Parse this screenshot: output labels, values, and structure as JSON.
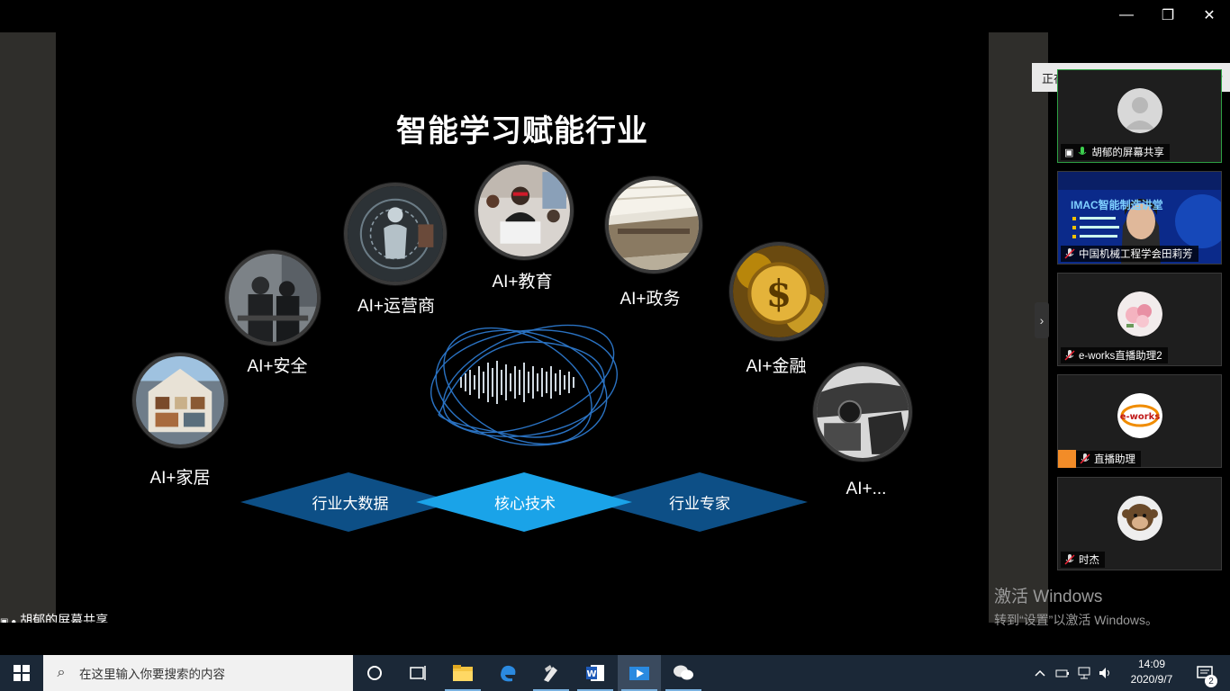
{
  "window": {
    "minimize_glyph": "—",
    "restore_glyph": "❐",
    "close_glyph": "✕"
  },
  "slide": {
    "title": "智能学习赋能行业",
    "items": [
      {
        "label": "AI+家居",
        "icon": "smart-home-image"
      },
      {
        "label": "AI+安全",
        "icon": "security-image"
      },
      {
        "label": "AI+运营商",
        "icon": "operator-image"
      },
      {
        "label": "AI+教育",
        "icon": "education-image"
      },
      {
        "label": "AI+政务",
        "icon": "government-image"
      },
      {
        "label": "AI+金融",
        "icon": "finance-image"
      },
      {
        "label": "AI+...",
        "icon": "car-image"
      }
    ],
    "pillars": [
      "行业大数据",
      "核心技术",
      "行业专家"
    ]
  },
  "share_label": "胡郁的屏幕共享",
  "meeting_panel": {
    "speaking": "正在讲话: 胡郁;",
    "participants": [
      {
        "name": "胡郁的屏幕共享",
        "active": true
      },
      {
        "name": "中国机械工程学会田莉芳",
        "active": false
      },
      {
        "name": "e-works直播助理2",
        "active": false
      },
      {
        "name": "直播助理",
        "active": false
      },
      {
        "name": "时杰",
        "active": false
      }
    ],
    "video_text": "IMAC智能制造讲堂"
  },
  "watermark": {
    "line1": "激活 Windows",
    "line2": "转到“设置”以激活 Windows。"
  },
  "taskbar": {
    "search_placeholder": "在这里输入你要搜索的内容",
    "time": "14:09",
    "date": "2020/9/7",
    "notification_count": "2",
    "colors": {
      "bar": "#1b2837",
      "accent": "#7ab2e0"
    }
  }
}
